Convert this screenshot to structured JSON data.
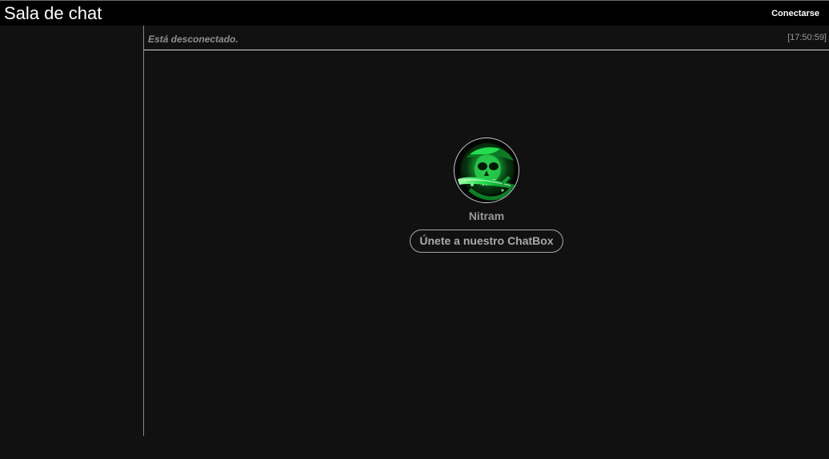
{
  "header": {
    "title": "Sala de chat",
    "connect_label": "Conectarse"
  },
  "status": {
    "message": "Está desconectado.",
    "time": "[17:50:59]"
  },
  "profile": {
    "name": "Nitram",
    "avatar_icon": "green-skull-pirate-icon",
    "join_label": "Únete a nuestro ChatBox"
  },
  "colors": {
    "background": "#111111",
    "topbar": "#000000",
    "avatar_accent": "#18d84a"
  }
}
